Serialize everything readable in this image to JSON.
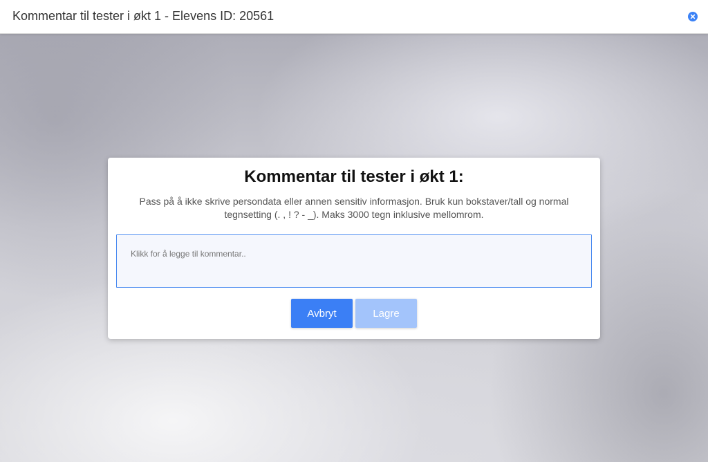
{
  "window": {
    "title": "Kommentar til tester i økt 1 - Elevens ID: 20561",
    "close_icon": "close-circle-icon",
    "accent_color": "#3b82f6"
  },
  "dialog": {
    "title": "Kommentar til tester i økt 1:",
    "description": "Pass på å ikke skrive persondata eller annen sensitiv informasjon. Bruk kun bokstaver/tall og normal tegnsetting (. , ! ? - _). Maks 3000 tegn inklusive mellomrom.",
    "comment": {
      "value": "",
      "placeholder": "Klikk for å legge til kommentar.."
    },
    "buttons": {
      "cancel_label": "Avbryt",
      "save_label": "Lagre"
    },
    "colors": {
      "primary": "#3b7ff5",
      "disabled": "#a3c4fb"
    }
  }
}
